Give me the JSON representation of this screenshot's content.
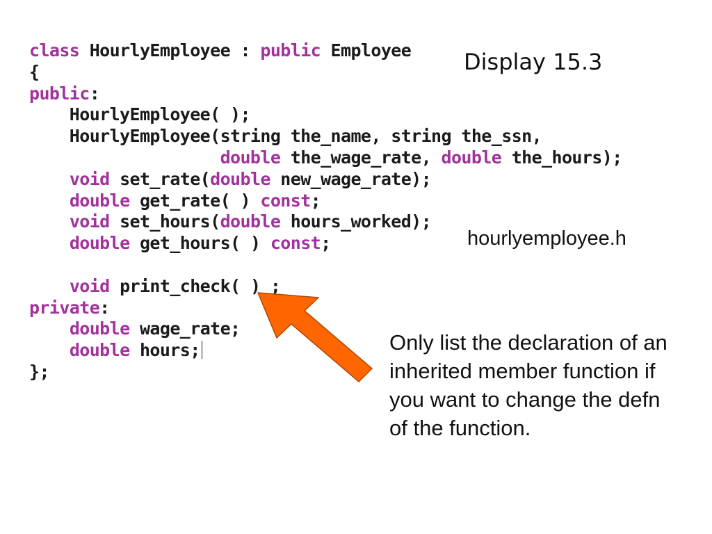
{
  "code": {
    "lines": [
      [
        {
          "t": "class",
          "k": true
        },
        {
          "t": " HourlyEmployee : ",
          "k": false
        },
        {
          "t": "public",
          "k": true
        },
        {
          "t": " Employee",
          "k": false
        }
      ],
      [
        {
          "t": "{",
          "k": false
        }
      ],
      [
        {
          "t": "public",
          "k": true
        },
        {
          "t": ":",
          "k": false
        }
      ],
      [
        {
          "t": "    HourlyEmployee( );",
          "k": false
        }
      ],
      [
        {
          "t": "    HourlyEmployee(string the_name, string the_ssn,",
          "k": false
        }
      ],
      [
        {
          "t": "                   ",
          "k": false
        },
        {
          "t": "double",
          "k": true
        },
        {
          "t": " the_wage_rate, ",
          "k": false
        },
        {
          "t": "double",
          "k": true
        },
        {
          "t": " the_hours);",
          "k": false
        }
      ],
      [
        {
          "t": "    ",
          "k": false
        },
        {
          "t": "void",
          "k": true
        },
        {
          "t": " set_rate(",
          "k": false
        },
        {
          "t": "double",
          "k": true
        },
        {
          "t": " new_wage_rate);",
          "k": false
        }
      ],
      [
        {
          "t": "    ",
          "k": false
        },
        {
          "t": "double",
          "k": true
        },
        {
          "t": " get_rate( ) ",
          "k": false
        },
        {
          "t": "const",
          "k": true
        },
        {
          "t": ";",
          "k": false
        }
      ],
      [
        {
          "t": "    ",
          "k": false
        },
        {
          "t": "void",
          "k": true
        },
        {
          "t": " set_hours(",
          "k": false
        },
        {
          "t": "double",
          "k": true
        },
        {
          "t": " hours_worked);",
          "k": false
        }
      ],
      [
        {
          "t": "    ",
          "k": false
        },
        {
          "t": "double",
          "k": true
        },
        {
          "t": " get_hours( ) ",
          "k": false
        },
        {
          "t": "const",
          "k": true
        },
        {
          "t": ";",
          "k": false
        }
      ],
      [],
      [
        {
          "t": "    ",
          "k": false
        },
        {
          "t": "void",
          "k": true
        },
        {
          "t": " print_check( ) ;",
          "k": false
        }
      ],
      [
        {
          "t": "private",
          "k": true
        },
        {
          "t": ":",
          "k": false
        }
      ],
      [
        {
          "t": "    ",
          "k": false
        },
        {
          "t": "double",
          "k": true
        },
        {
          "t": " wage_rate;",
          "k": false
        }
      ],
      [
        {
          "t": "    ",
          "k": false
        },
        {
          "t": "double",
          "k": true
        },
        {
          "t": " hours;",
          "k": false
        }
      ],
      [
        {
          "t": "};",
          "k": false
        }
      ]
    ],
    "cursor_line": 14,
    "keyword_color": "#a2319b",
    "text_color": "#1a1a1a"
  },
  "display_title": "Display 15.3",
  "filename": "hourlyemployee.h",
  "note": "Only list the declaration of an inherited member function if you want to change the defn of the function.",
  "arrow": {
    "fill": "#ff6600",
    "stroke": "#b34700"
  }
}
